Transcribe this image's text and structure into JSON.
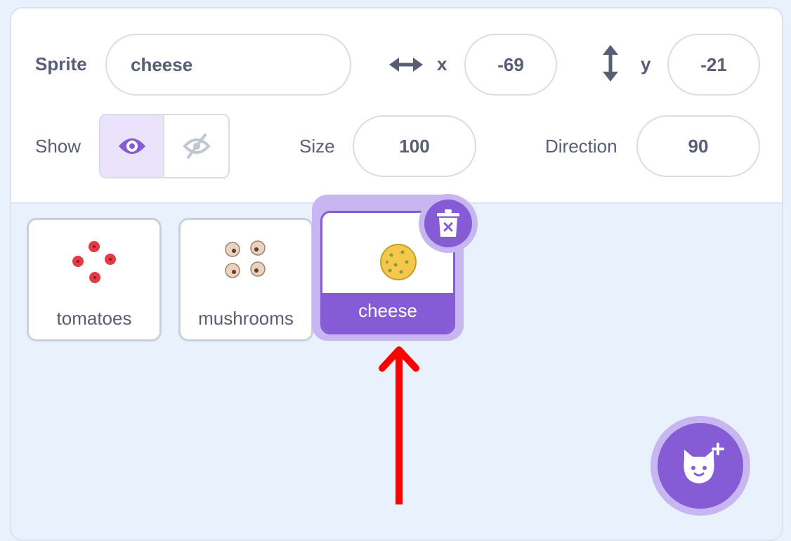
{
  "sprite_info": {
    "sprite_label": "Sprite",
    "sprite_name": "cheese",
    "x_label": "x",
    "x_value": "-69",
    "y_label": "y",
    "y_value": "-21",
    "show_label": "Show",
    "size_label": "Size",
    "size_value": "100",
    "direction_label": "Direction",
    "direction_value": "90",
    "visible": true
  },
  "sprites": [
    {
      "name": "tomatoes",
      "selected": false
    },
    {
      "name": "mushrooms",
      "selected": false
    },
    {
      "name": "cheese",
      "selected": true
    }
  ],
  "icons": {
    "x_arrow": "horizontal-arrows-icon",
    "y_arrow": "vertical-arrows-icon",
    "show": "eye-icon",
    "hide": "eye-slash-icon",
    "delete": "trash-icon",
    "add_sprite": "cat-plus-icon",
    "annotation": "red-arrow-icon"
  },
  "colors": {
    "accent": "#855cd6",
    "accent_light": "#c7b6f1",
    "text": "#575e75",
    "background": "#e9f1fc",
    "annotation": "#ff0000"
  }
}
